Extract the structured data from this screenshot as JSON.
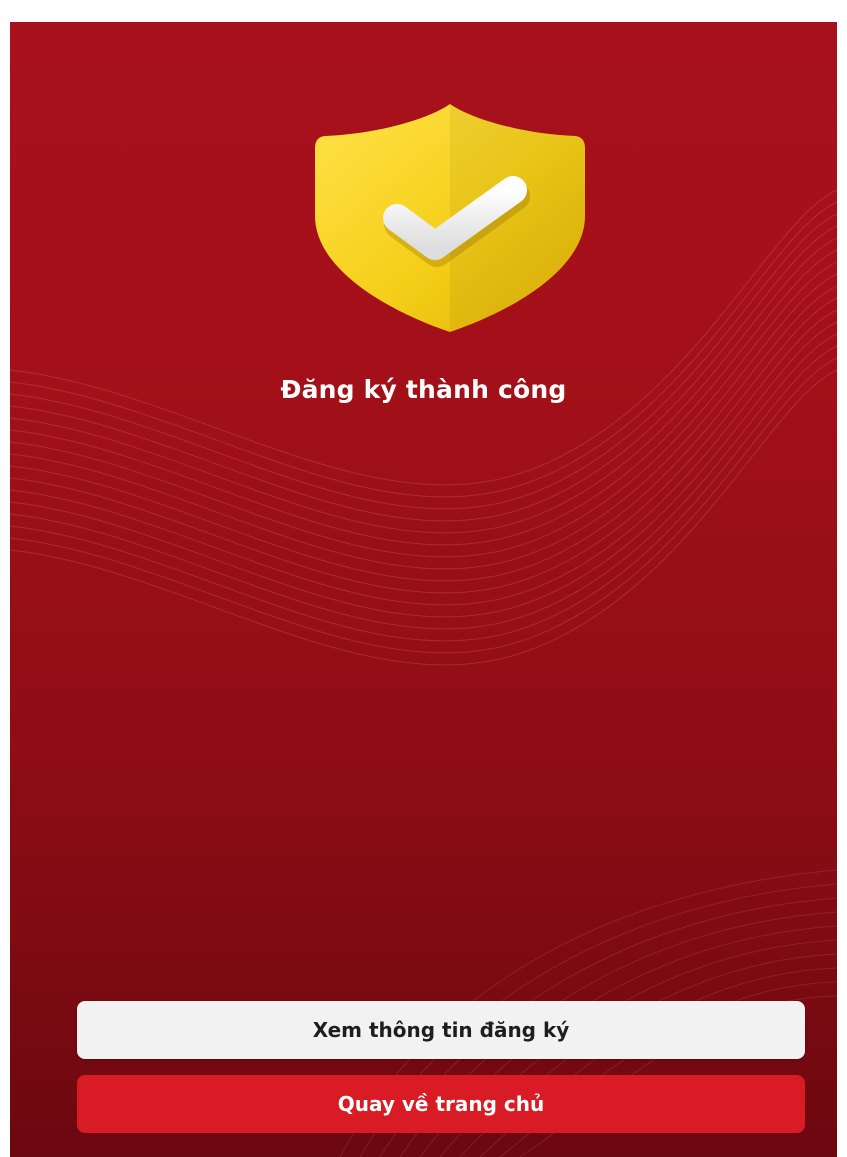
{
  "screen": {
    "title": "Đăng ký thành công",
    "icon": "shield-check-icon",
    "colors": {
      "background_top": "#a8111c",
      "background_bottom": "#6c0810",
      "shield": "#f5cf18",
      "primary_button": "#d81b25",
      "secondary_button": "#f2f2f2"
    }
  },
  "actions": {
    "view_info_label": "Xem thông tin đăng ký",
    "go_home_label": "Quay về trang chủ"
  }
}
